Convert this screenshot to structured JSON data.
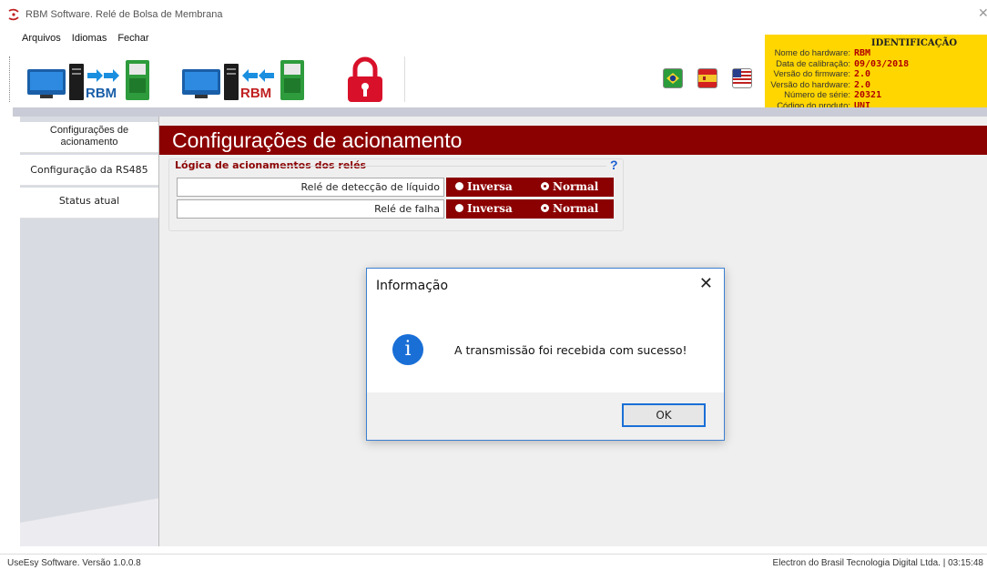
{
  "window": {
    "title": "RBM Software. Relé de Bolsa de Membrana"
  },
  "menu": {
    "items": [
      "Arquivos",
      "Idiomas",
      "Fechar"
    ]
  },
  "toolbar": {
    "send_label": "RBM",
    "receive_label": "RBM"
  },
  "identification": {
    "header": "IDENTIFICAÇÃO",
    "rows": [
      {
        "label": "Nome do hardware:",
        "value": "RBM"
      },
      {
        "label": "Data de calibração:",
        "value": "09/03/2018"
      },
      {
        "label": "Versão do firmware:",
        "value": "2.0"
      },
      {
        "label": "Versão do hardware:",
        "value": "2.0"
      },
      {
        "label": "Número de série:",
        "value": "20321"
      },
      {
        "label": "Código do produto:",
        "value": "UNI"
      }
    ]
  },
  "sidebar": {
    "items": [
      {
        "label": "Configurações de acionamento"
      },
      {
        "label": "Configuração da RS485"
      },
      {
        "label": "Status atual"
      }
    ]
  },
  "main": {
    "header": "Configurações de acionamento",
    "group_title": "Lógica de acionamentos dos relés",
    "help": "?",
    "rows": [
      {
        "label": "Relé de detecção de líquido",
        "opt1": "Inversa",
        "opt2": "Normal"
      },
      {
        "label": "Relé de falha",
        "opt1": "Inversa",
        "opt2": "Normal"
      }
    ]
  },
  "dialog": {
    "title": "Informação",
    "message": "A transmissão foi recebida com sucesso!",
    "ok_label": "OK",
    "icon_glyph": "i",
    "close_glyph": "✕"
  },
  "statusbar": {
    "left": "UseEsy Software. Versão 1.0.0.8",
    "right": "Electron do Brasil Tecnologia Digital Ltda.  |  03:15:48"
  },
  "colors": {
    "accent": "#8b0000",
    "ident_bg": "#ffd600",
    "dialog_blue": "#1a6fd6"
  }
}
